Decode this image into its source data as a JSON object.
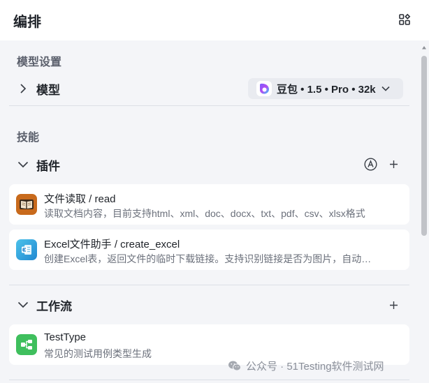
{
  "header": {
    "title": "编排"
  },
  "sections": {
    "model_settings": {
      "label": "模型设置",
      "model_row_label": "模型",
      "model_select_value": "豆包 • 1.5 • Pro • 32k"
    },
    "skills": {
      "label": "技能",
      "plugins": {
        "label": "插件",
        "items": [
          {
            "title": "文件读取 / read",
            "description": "读取文档内容，目前支持html、xml、doc、docx、txt、pdf、csv、xlsx格式",
            "icon": "book-plugin-icon"
          },
          {
            "title": "Excel文件助手 / create_excel",
            "description": "创建Excel表，返回文件的临时下载链接。支持识别链接是否为图片，自动…",
            "icon": "excel-plugin-icon"
          }
        ]
      },
      "workflow": {
        "label": "工作流",
        "items": [
          {
            "title": "TestType",
            "description": "常见的测试用例类型生成",
            "icon": "workflow-icon"
          }
        ]
      }
    }
  },
  "watermark": {
    "text": "公众号 · 51Testing软件测试网"
  },
  "colors": {
    "background": "#f4f5f8",
    "card": "#ffffff",
    "model_select_bg": "#e9ebf0",
    "workflow_green": "#3fbf5d",
    "excel_blue": "#2fa8de",
    "plugin_orange": "#c86a1c"
  }
}
